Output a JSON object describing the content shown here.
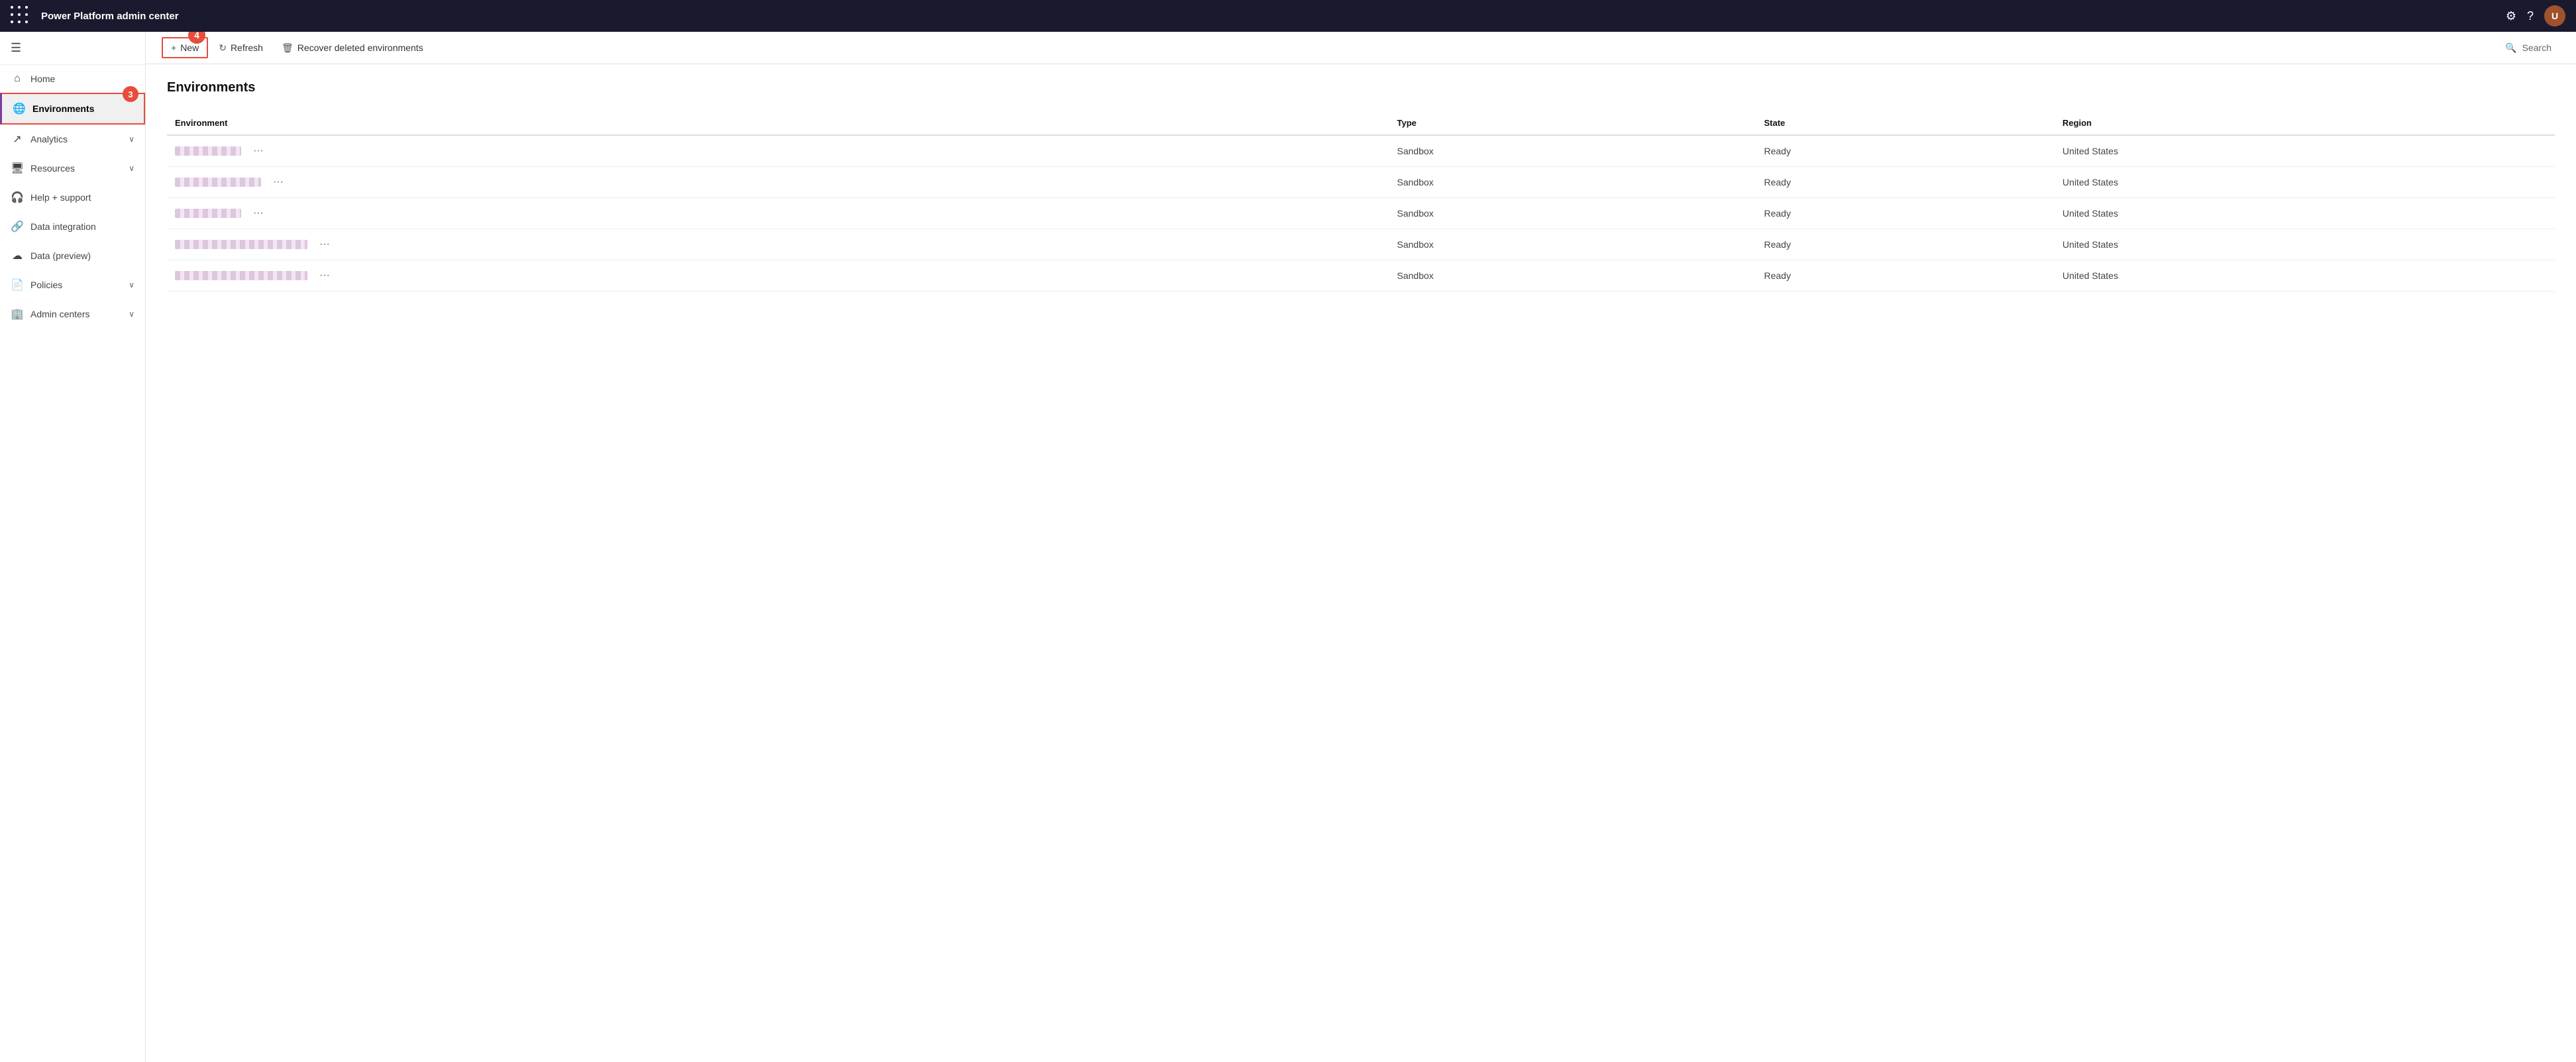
{
  "app": {
    "title": "Power Platform admin center"
  },
  "topnav": {
    "settings_label": "Settings",
    "help_label": "Help",
    "avatar_initials": "U"
  },
  "sidebar": {
    "hamburger_label": "☰",
    "items": [
      {
        "id": "home",
        "label": "Home",
        "icon": "⌂",
        "active": false,
        "expandable": false
      },
      {
        "id": "environments",
        "label": "Environments",
        "icon": "🌐",
        "active": true,
        "expandable": false,
        "badge": "3"
      },
      {
        "id": "analytics",
        "label": "Analytics",
        "icon": "↗",
        "active": false,
        "expandable": true
      },
      {
        "id": "resources",
        "label": "Resources",
        "icon": "🖥",
        "active": false,
        "expandable": true
      },
      {
        "id": "help-support",
        "label": "Help + support",
        "icon": "🎧",
        "active": false,
        "expandable": false
      },
      {
        "id": "data-integration",
        "label": "Data integration",
        "icon": "🔗",
        "active": false,
        "expandable": false
      },
      {
        "id": "data-preview",
        "label": "Data (preview)",
        "icon": "☁",
        "active": false,
        "expandable": false
      },
      {
        "id": "policies",
        "label": "Policies",
        "icon": "📄",
        "active": false,
        "expandable": true
      },
      {
        "id": "admin-centers",
        "label": "Admin centers",
        "icon": "🏢",
        "active": false,
        "expandable": true
      }
    ]
  },
  "toolbar": {
    "new_label": "New",
    "refresh_label": "Refresh",
    "recover_label": "Recover deleted environments",
    "search_label": "Search",
    "callout_4": "4"
  },
  "environments": {
    "title": "Environments",
    "columns": {
      "environment": "Environment",
      "type": "Type",
      "state": "State",
      "region": "Region"
    },
    "rows": [
      {
        "name_width": "short",
        "type": "Sandbox",
        "state": "Ready",
        "region": "United States"
      },
      {
        "name_width": "medium",
        "type": "Sandbox",
        "state": "Ready",
        "region": "United States"
      },
      {
        "name_width": "short",
        "type": "Sandbox",
        "state": "Ready",
        "region": "United States"
      },
      {
        "name_width": "long",
        "type": "Sandbox",
        "state": "Ready",
        "region": "United States"
      },
      {
        "name_width": "long",
        "type": "Sandbox",
        "state": "Ready",
        "region": "United States"
      }
    ]
  }
}
